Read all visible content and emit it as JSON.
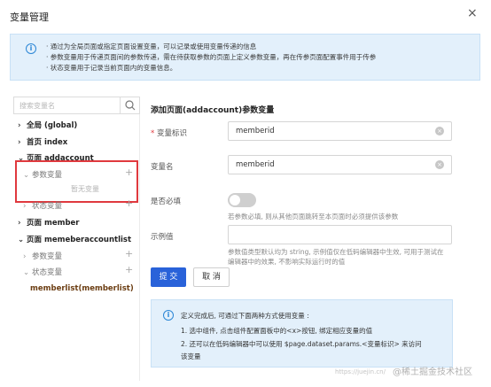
{
  "dialog": {
    "title": "变量管理",
    "close_symbol": "×"
  },
  "top_info": {
    "lines": [
      "· 通过为全局页面或指定页面设置变量，可以记录或使用变量传递的信息",
      "· 参数变量用于传递页面间的参数传递，需在待获取参数的页面上定义参数变量，再在传参页面配置事件用于传参",
      "· 状态变量用于记录当前页面内的变量信息。"
    ]
  },
  "left": {
    "search_placeholder": "搜索变量名",
    "tree": [
      {
        "label": "全局 (global)",
        "arrow": "›",
        "type": "bold"
      },
      {
        "label": "首页 index",
        "arrow": "›",
        "type": "bold"
      },
      {
        "label": "页面 addaccount",
        "arrow": "⌄",
        "type": "bold"
      },
      {
        "label": "参数变量",
        "arrow": "›",
        "type": "sub"
      },
      {
        "label": "状态变量",
        "arrow": "›",
        "type": "sub"
      },
      {
        "label": "页面 member",
        "arrow": "›",
        "type": "bold"
      },
      {
        "label": "页面 memeberaccountlist",
        "arrow": "⌄",
        "type": "bold"
      },
      {
        "label": "参数变量",
        "arrow": "›",
        "type": "sub"
      },
      {
        "label": "状态变量",
        "arrow": "⌄",
        "type": "sub"
      },
      {
        "label": "memberlist(memberlist)",
        "arrow": "",
        "type": "bold"
      }
    ],
    "empty_text": "暂无变量",
    "plus_symbol": "+"
  },
  "form": {
    "section_title": "添加页面(addaccount)参数变量",
    "var_id_label": "变量标识",
    "required_mark": "*",
    "var_id_value": "memberid",
    "var_name_label": "变量名",
    "var_name_value": "memberid",
    "required_toggle_label": "是否必填",
    "required_toggle_on": false,
    "required_hint": "若参数必填, 则从其他页面跳转至本页面时必须提供该参数",
    "example_label": "示例值",
    "example_value": "",
    "example_hint": [
      "参数值类型默认均为 string, 示例值仅在低码编辑器中生效, 可用于测试在",
      "编辑器中的效果, 不影响实际运行时的值"
    ],
    "ok_label": "提 交",
    "cancel_label": "取 消"
  },
  "bottom_info": {
    "heading": "定义完成后, 可通过下面两种方式使用变量 :",
    "line1": "1. 选中组件, 点击组件配置面板中的<x>按钮, 绑定相应变量的值",
    "line2": "2. 还可以在低码编辑器中可以使用 $page.dataset.params.<变量标识> 来访问",
    "line3": "该变量"
  },
  "watermark": {
    "main": "@稀土掘金技术社区",
    "mid": "https://juejin.cn/"
  },
  "colors": {
    "primary": "#2962d9",
    "info_bg": "#e3f0fb",
    "highlight_border": "#e0393e"
  }
}
